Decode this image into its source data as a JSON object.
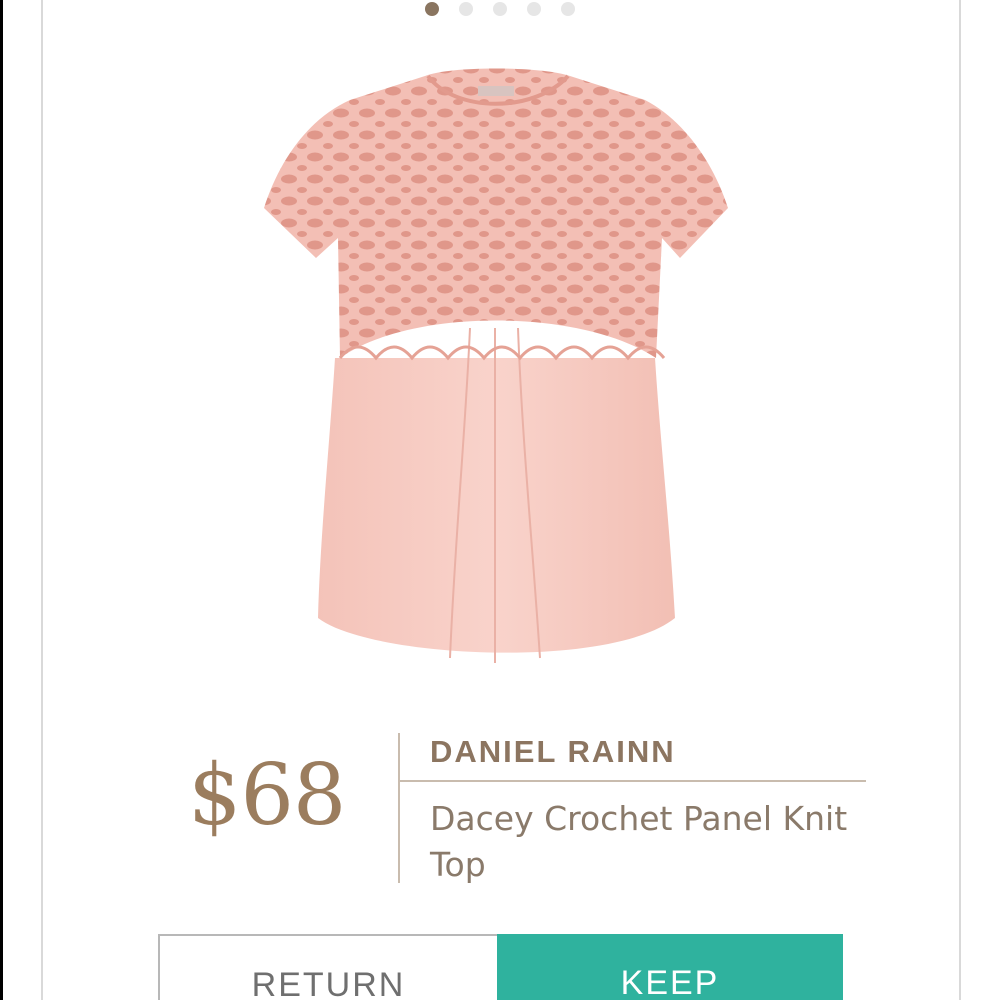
{
  "carousel": {
    "total_slides": 5,
    "active_slide": 1
  },
  "product": {
    "price": "$68",
    "brand": "DANIEL RAINN",
    "title": "Dacey Crochet Panel Knit Top",
    "image_icon": "blouse-photo"
  },
  "actions": {
    "return_label": "RETURN",
    "keep_label": "KEEP"
  },
  "colors": {
    "accent_brown": "#9b7d5e",
    "keep_teal": "#2fb29e",
    "garment_pink": "#f6c9c0"
  }
}
